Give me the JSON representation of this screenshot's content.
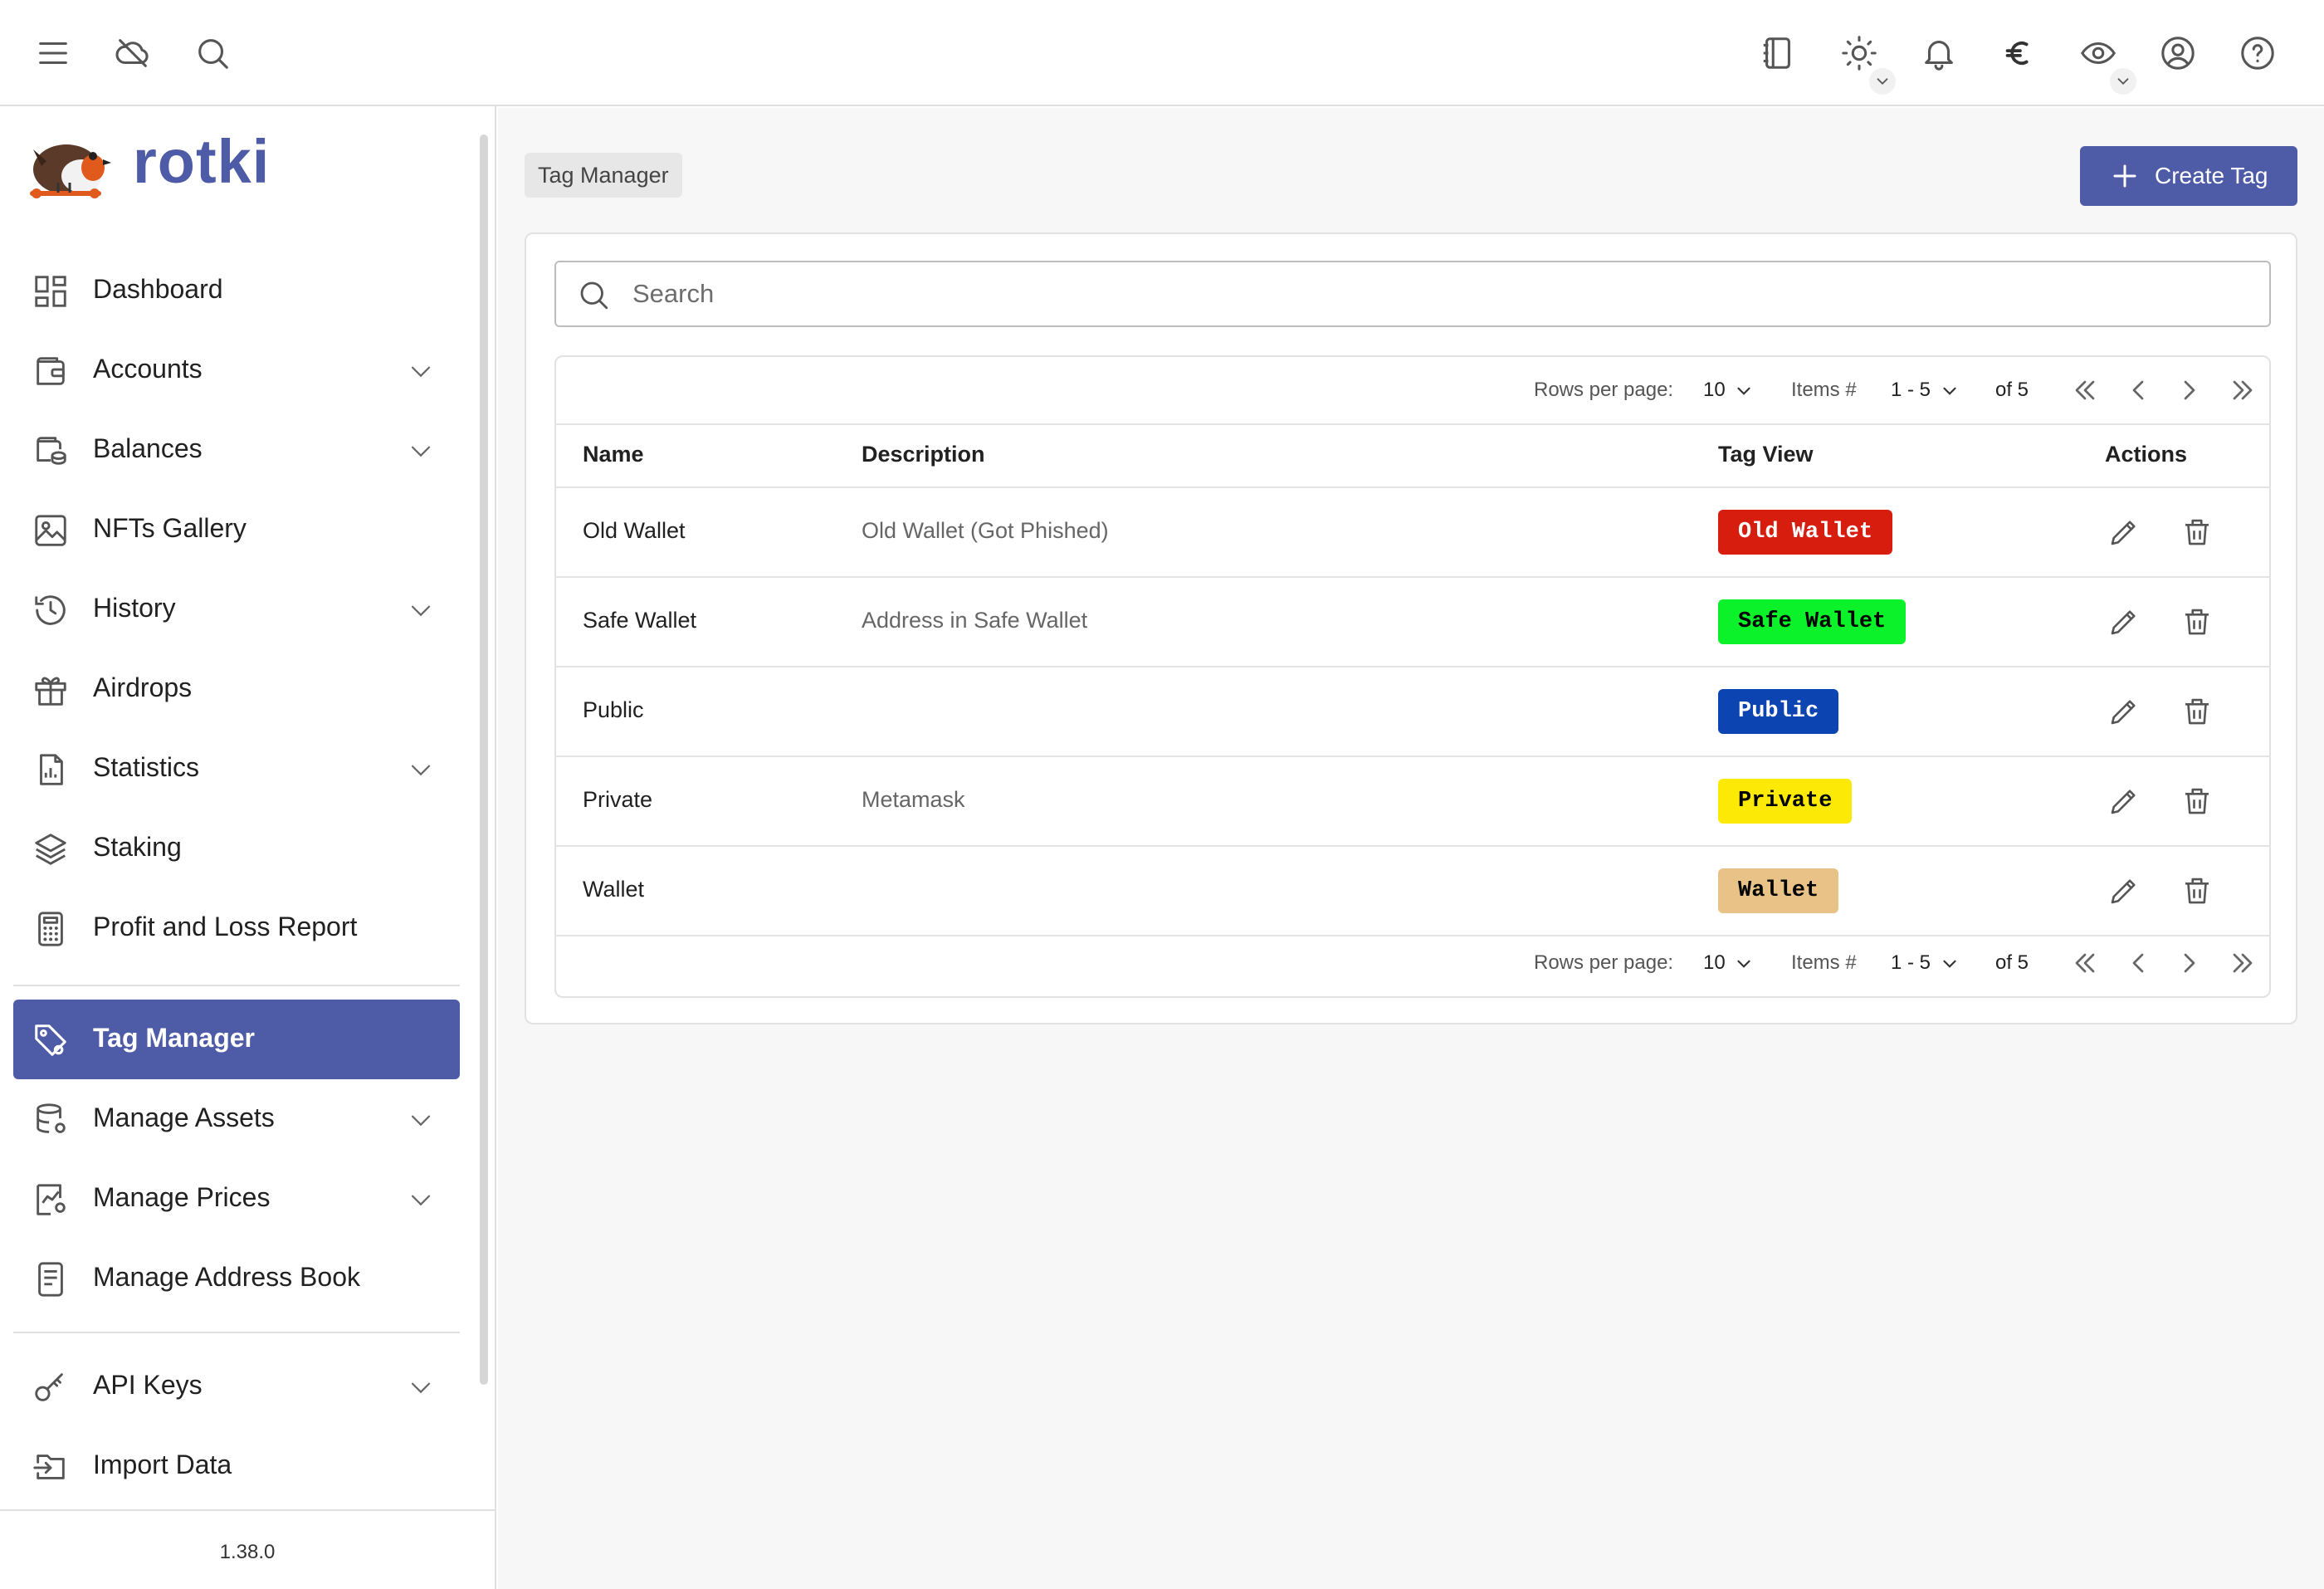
{
  "topbar": {
    "icons": [
      "menu-icon",
      "cloud-off-icon",
      "search-icon",
      "notebook-icon",
      "sun-icon",
      "bell-icon",
      "euro-icon",
      "eye-icon",
      "user-circle-icon",
      "help-circle-icon"
    ]
  },
  "sidebar": {
    "brand": "rotki",
    "items": [
      {
        "label": "Dashboard"
      },
      {
        "label": "Accounts"
      },
      {
        "label": "Balances"
      },
      {
        "label": "NFTs Gallery"
      },
      {
        "label": "History"
      },
      {
        "label": "Airdrops"
      },
      {
        "label": "Statistics"
      },
      {
        "label": "Staking"
      },
      {
        "label": "Profit and Loss Report"
      },
      {
        "label": "Tag Manager"
      },
      {
        "label": "Manage Assets"
      },
      {
        "label": "Manage Prices"
      },
      {
        "label": "Manage Address Book"
      },
      {
        "label": "API Keys"
      },
      {
        "label": "Import Data"
      }
    ],
    "version": "1.38.0"
  },
  "main": {
    "breadcrumb": "Tag Manager",
    "create_label": "Create Tag",
    "search_placeholder": "Search",
    "pager": {
      "rows_per_page_label": "Rows per page:",
      "rows_per_page_value": "10",
      "items_label": "Items #",
      "items_range": "1 - 5",
      "of_total": "of 5"
    },
    "columns": [
      "Name",
      "Description",
      "Tag View",
      "Actions"
    ],
    "rows": [
      {
        "name": "Old Wallet",
        "description": "Old Wallet (Got Phished)",
        "tag": "Old Wallet",
        "bg": "#d71d0e",
        "fg": "#ffffff"
      },
      {
        "name": "Safe Wallet",
        "description": "Address in Safe Wallet",
        "tag": "Safe Wallet",
        "bg": "#0bf22a",
        "fg": "#000000"
      },
      {
        "name": "Public",
        "description": "",
        "tag": "Public",
        "bg": "#0c44b2",
        "fg": "#ffffff"
      },
      {
        "name": "Private",
        "description": "Metamask",
        "tag": "Private",
        "bg": "#fcea06",
        "fg": "#000000"
      },
      {
        "name": "Wallet",
        "description": "",
        "tag": "Wallet",
        "bg": "#e8c287",
        "fg": "#000000"
      }
    ]
  },
  "colors": {
    "accent": "#4e5ba6"
  }
}
